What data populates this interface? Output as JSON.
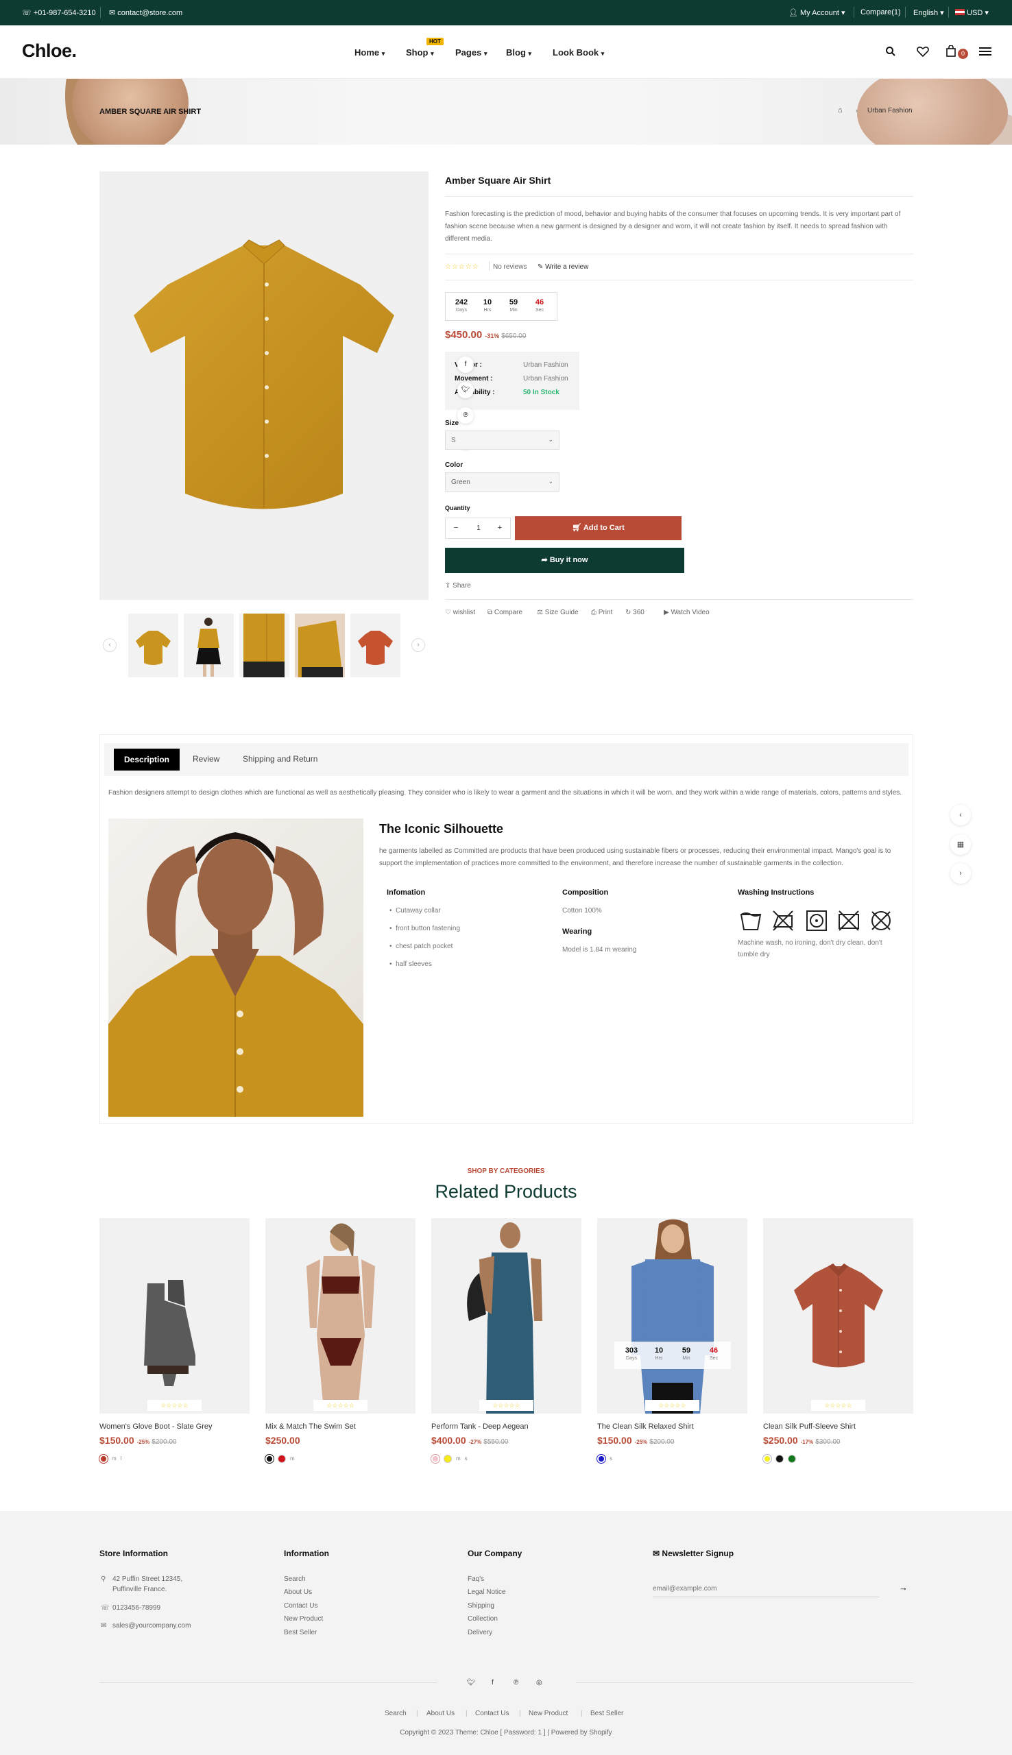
{
  "topbar": {
    "phone": "+01-987-654-3210",
    "email": "contact@store.com",
    "account": "My Account",
    "compare": "Compare(1)",
    "language": "English",
    "currency": "USD"
  },
  "header": {
    "logo": "Chloe.",
    "nav": [
      "Home",
      "Shop",
      "Pages",
      "Blog",
      "Look Book"
    ],
    "hot_badge": "HOT",
    "cart_count": "0"
  },
  "breadcrumb": {
    "title": "AMBER SQUARE AIR SHIRT",
    "current": "Urban Fashion"
  },
  "product": {
    "title": "Amber Square Air Shirt",
    "description": "Fashion forecasting is the prediction of mood, behavior and buying habits of the consumer that focuses on upcoming trends. It is very important part of fashion scene because when a new garment is designed by a designer and worn, it will not create fashion by itself. It needs to spread fashion with different media.",
    "reviews": "No reviews",
    "write_review": "Write a review",
    "countdown": [
      {
        "value": "242",
        "unit": "Days"
      },
      {
        "value": "10",
        "unit": "Hrs"
      },
      {
        "value": "59",
        "unit": "Min"
      },
      {
        "value": "46",
        "unit": "Sec"
      }
    ],
    "price": "$450.00",
    "discount": "-31%",
    "old_price": "$650.00",
    "info": [
      {
        "key": "Vendor :",
        "value": "Urban Fashion"
      },
      {
        "key": "Movement :",
        "value": "Urban Fashion"
      },
      {
        "key": "Availability :",
        "value": "50 In Stock"
      }
    ],
    "size_label": "Size",
    "size_value": "S",
    "color_label": "Color",
    "color_value": "Green",
    "quantity_label": "Quantity",
    "quantity": "1",
    "add_to_cart": "Add to Cart",
    "buy_now": "Buy it now",
    "share": "Share",
    "actions": [
      "wishlist",
      "Compare",
      "Size Guide",
      "Print",
      "360",
      "Watch Video"
    ]
  },
  "tabs": {
    "items": [
      "Description",
      "Review",
      "Shipping and Return"
    ],
    "intro": "Fashion designers attempt to design clothes which are functional as well as aesthetically pleasing. They consider who is likely to wear a garment and the situations in which it will be worn, and they work within a wide range of materials, colors, patterns and styles.",
    "heading": "The Iconic Silhouette",
    "body": "he garments labelled as Committed are products that have been produced using sustainable fibers or processes, reducing their environmental impact. Mango's goal is to support the implementation of practices more committed to the environment, and therefore increase the number of sustainable garments in the collection.",
    "info_heading": "Infomation",
    "info_items": [
      "Cutaway collar",
      "front button fastening",
      "chest patch pocket",
      "half sleeves"
    ],
    "composition_heading": "Composition",
    "composition": "Cotton 100%",
    "wearing_heading": "Wearing",
    "wearing": "Model is 1.84 m wearing",
    "washing_heading": "Washing Instructions",
    "washing_text": "Machine wash, no ironing, don't dry clean, don't tumble dry"
  },
  "related": {
    "subtitle": "SHOP BY CATEGORIES",
    "title": "Related Products",
    "products": [
      {
        "name": "Women's Glove Boot - Slate Grey",
        "price": "$150.00",
        "discount": "-25%",
        "old": "$200.00",
        "colors": [
          "#b83a2a"
        ],
        "sizes": [
          "m",
          "l"
        ]
      },
      {
        "name": "Mix & Match The Swim Set",
        "price": "$250.00",
        "discount": "",
        "old": "",
        "colors": [
          "#111111",
          "#d0141c"
        ],
        "sizes": [
          "m"
        ]
      },
      {
        "name": "Perform Tank - Deep Aegean",
        "price": "$400.00",
        "discount": "-27%",
        "old": "$550.00",
        "colors": [
          "#f3c4cc",
          "#f7ea1a"
        ],
        "sizes": [
          "m",
          "s"
        ]
      },
      {
        "name": "The Clean Silk Relaxed Shirt",
        "price": "$150.00",
        "discount": "-25%",
        "old": "$200.00",
        "colors": [
          "#1a18c8"
        ],
        "sizes": [
          "s"
        ]
      },
      {
        "name": "Clean Silk Puff-Sleeve Shirt",
        "price": "$250.00",
        "discount": "-17%",
        "old": "$300.00",
        "colors": [
          "#f5f01c",
          "#111111",
          "#127a1c"
        ],
        "sizes": []
      }
    ],
    "countdown": [
      {
        "value": "303",
        "unit": "Days"
      },
      {
        "value": "10",
        "unit": "Hrs"
      },
      {
        "value": "59",
        "unit": "Min"
      },
      {
        "value": "46",
        "unit": "Sec"
      }
    ]
  },
  "footer": {
    "store_heading": "Store Information",
    "address1": "42 Puffin Street 12345,",
    "address2": "Puffinville France.",
    "phone": "0123456-78999",
    "email": "sales@yourcompany.com",
    "info_heading": "Information",
    "info_links": [
      "Search",
      "About Us",
      "Contact Us",
      "New Product",
      "Best Seller"
    ],
    "company_heading": "Our Company",
    "company_links": [
      "Faq's",
      "Legal Notice",
      "Shipping",
      "Collection",
      "Delivery"
    ],
    "newsletter_heading": "Newsletter Signup",
    "newsletter_placeholder": "email@example.com",
    "bottom_links": [
      "Search",
      "About Us",
      "Contact Us",
      "New Product",
      "Best Seller"
    ],
    "copyright": "Copyright © 2023 Theme: Chloe [ Password: 1 ] | Powered by Shopify"
  },
  "colors": {
    "brand_dark": "#0d3b32",
    "accent": "#b84a36",
    "star": "#f3c622",
    "in_stock": "#2bb673"
  }
}
